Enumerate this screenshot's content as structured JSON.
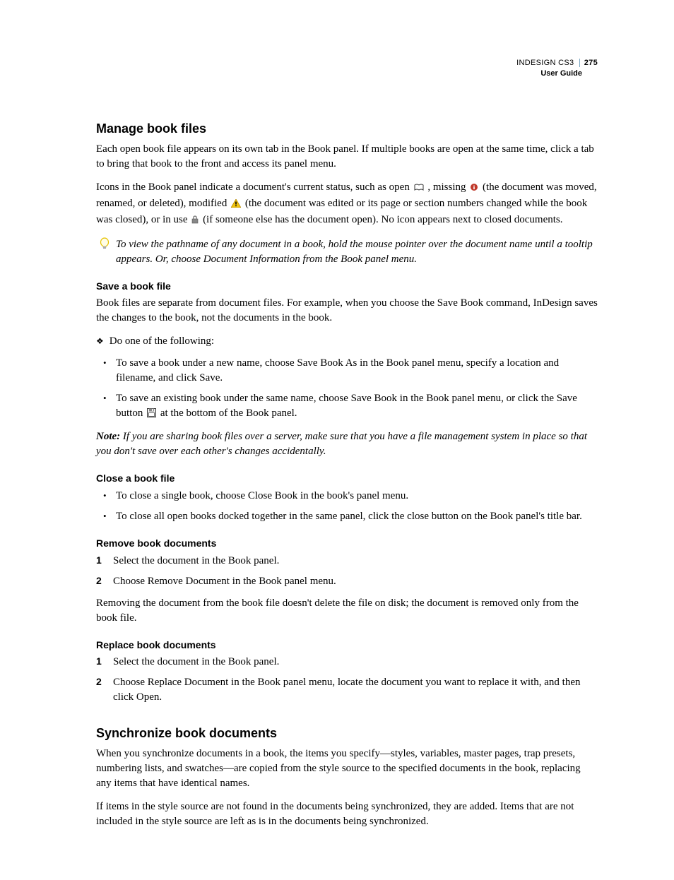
{
  "header": {
    "product": "INDESIGN CS3",
    "page_number": "275",
    "doc_type": "User Guide"
  },
  "s1": {
    "title": "Manage book files",
    "p1": "Each open book file appears on its own tab in the Book panel. If multiple books are open at the same time, click a tab to bring that book to the front and access its panel menu.",
    "p2a": "Icons in the Book panel indicate a document's current status, such as open ",
    "p2b": ", missing ",
    "p2c": " (the document was moved, renamed, or deleted), modified ",
    "p2d": " (the document was edited or its page or section numbers changed while the book was closed), or in use ",
    "p2e": " (if someone else has the document open). No icon appears next to closed documents.",
    "tip": "To view the pathname of any document in a book, hold the mouse pointer over the document name until a tooltip appears. Or, choose Document Information from the Book panel menu."
  },
  "save": {
    "heading": "Save a book file",
    "p1": "Book files are separate from document files. For example, when you choose the Save Book command, InDesign saves the changes to the book, not the documents in the book.",
    "lead": "Do one of the following:",
    "b1": "To save a book under a new name, choose Save Book As in the Book panel menu, specify a location and filename, and click Save.",
    "b2a": "To save an existing book under the same name, choose Save Book in the Book panel menu, or click the Save button ",
    "b2b": " at the bottom of the Book panel.",
    "note_label": "Note:",
    "note": " If you are sharing book files over a server, make sure that you have a file management system in place so that you don't save over each other's changes accidentally."
  },
  "close": {
    "heading": "Close a book file",
    "b1": "To close a single book, choose Close Book in the book's panel menu.",
    "b2": "To close all open books docked together in the same panel, click the close button on the Book panel's title bar."
  },
  "remove": {
    "heading": "Remove book documents",
    "s1": "Select the document in the Book panel.",
    "s2": "Choose Remove Document in the Book panel menu.",
    "p": "Removing the document from the book file doesn't delete the file on disk; the document is removed only from the book file."
  },
  "replace": {
    "heading": "Replace book documents",
    "s1": "Select the document in the Book panel.",
    "s2": "Choose Replace Document in the Book panel menu, locate the document you want to replace it with, and then click Open."
  },
  "sync": {
    "title": "Synchronize book documents",
    "p1": "When you synchronize documents in a book, the items you specify—styles, variables, master pages, trap presets, numbering lists, and swatches—are copied from the style source to the specified documents in the book, replacing any items that have identical names.",
    "p2": "If items in the style source are not found in the documents being synchronized, they are added. Items that are not included in the style source are left as is in the documents being synchronized."
  }
}
